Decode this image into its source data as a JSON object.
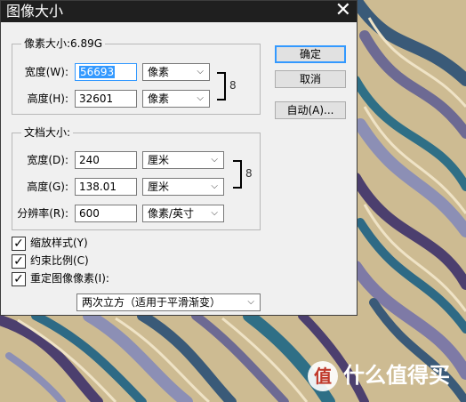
{
  "window": {
    "title": "图像大小",
    "close_glyph": "✕"
  },
  "pixel_dims": {
    "legend": "像素大小:6.89G",
    "width_label": "宽度(W):",
    "width_value": "56693",
    "width_unit": "像素",
    "height_label": "高度(H):",
    "height_value": "32601",
    "height_unit": "像素"
  },
  "doc_size": {
    "legend": "文档大小:",
    "width_label": "宽度(D):",
    "width_value": "240",
    "width_unit": "厘米",
    "height_label": "高度(G):",
    "height_value": "138.01",
    "height_unit": "厘米",
    "resolution_label": "分辨率(R):",
    "resolution_value": "600",
    "resolution_unit": "像素/英寸"
  },
  "buttons": {
    "ok": "确定",
    "cancel": "取消",
    "auto": "自动(A)..."
  },
  "options": {
    "scale_styles": "缩放样式(Y)",
    "constrain": "约束比例(C)",
    "resample": "重定图像像素(I):",
    "resample_method": "两次立方（适用于平滑渐变）"
  },
  "watermark": {
    "logo": "值",
    "text": "什么值得买"
  },
  "colors": {
    "titlebar": "#1f1f1f",
    "dialog_bg": "#f0f0f0",
    "accent": "#3399ff"
  }
}
